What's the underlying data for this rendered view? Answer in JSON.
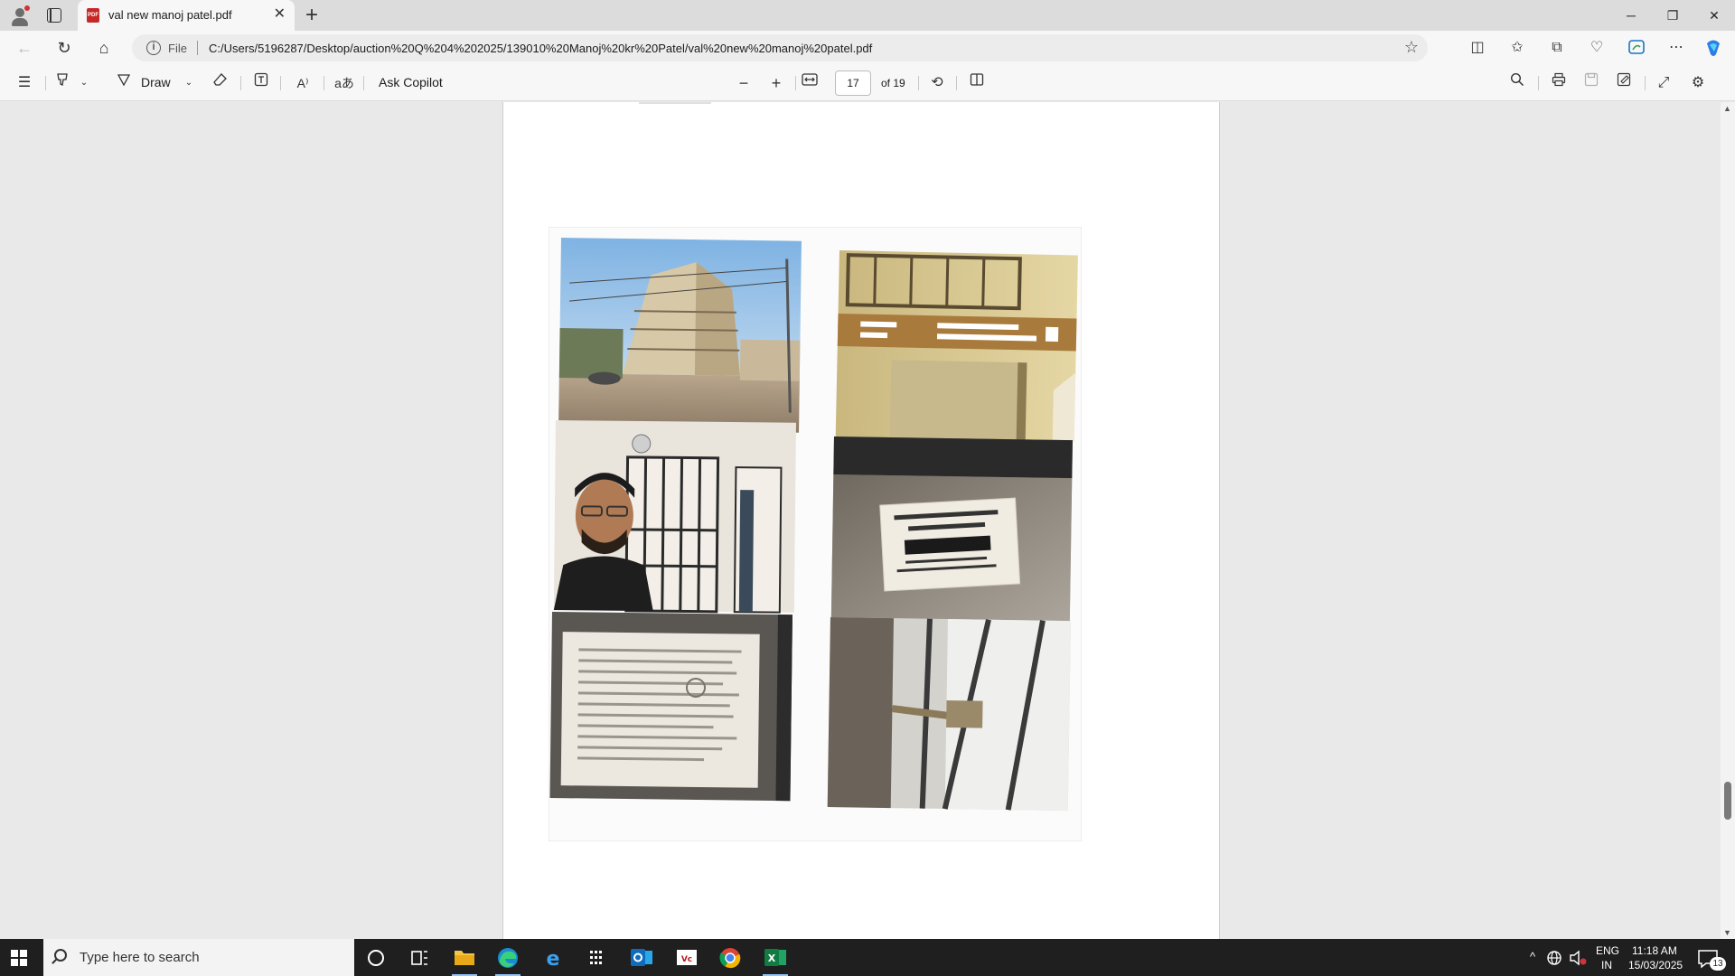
{
  "browser": {
    "tab": {
      "title": "val new manoj patel.pdf",
      "icon": "pdf-file-icon"
    },
    "address": {
      "scheme_label": "File",
      "url": "C:/Users/5196287/Desktop/auction%20Q%204%202025/139010%20Manoj%20kr%20Patel/val%20new%20manoj%20patel.pdf"
    }
  },
  "pdf_toolbar": {
    "draw_label": "Draw",
    "ask_copilot_label": "Ask Copilot",
    "current_page": "17",
    "page_total_label": "of 19"
  },
  "taskbar": {
    "search_placeholder": "Type here to search",
    "language": "ENG",
    "region": "IN",
    "time": "11:18 AM",
    "date": "15/03/2025",
    "notification_count": "13"
  },
  "document": {
    "photos": [
      {
        "name": "building-exterior-photo"
      },
      {
        "name": "complex-signboard-photo"
      },
      {
        "name": "selfie-at-gate-photo"
      },
      {
        "name": "panchayat-number-plate-photo"
      },
      {
        "name": "notice-on-door-photo"
      },
      {
        "name": "grille-door-photo"
      }
    ]
  }
}
